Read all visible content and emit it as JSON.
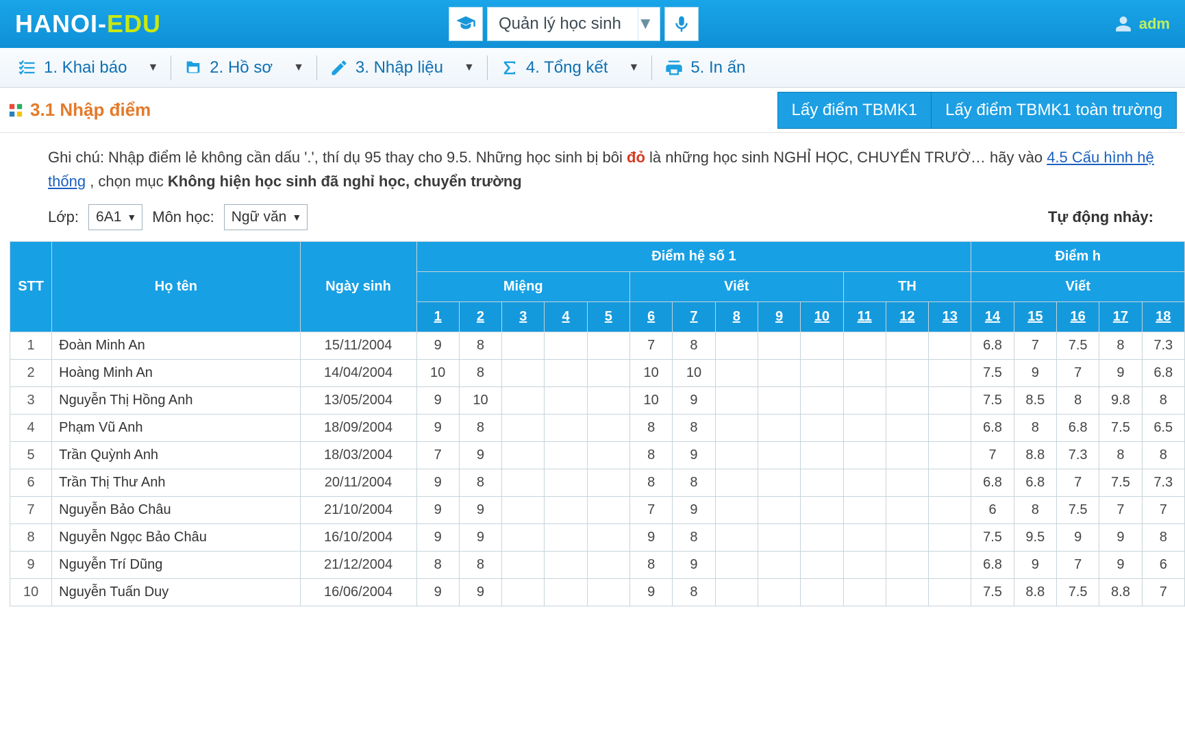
{
  "brand": {
    "part1": "HANOI-",
    "part2": "EDU"
  },
  "topbar": {
    "module_label": "Quản lý học sinh",
    "user": "adm"
  },
  "menu": {
    "m1": "1. Khai báo",
    "m2": "2. Hồ sơ",
    "m3": "3. Nhập liệu",
    "m4": "4. Tổng kết",
    "m5": "5. In ấn"
  },
  "section": {
    "title": "3.1 Nhập điểm",
    "btn1": "Lấy điểm TBMK1",
    "btn2": "Lấy điểm TBMK1 toàn trường"
  },
  "note": {
    "pre": "Ghi chú: Nhập điểm lẻ không cần dấu '.', thí dụ 95 thay cho 9.5. Những học sinh bị bôi ",
    "red": "đỏ",
    "post1": " là những học sinh NGHỈ HỌC, CHUYỂN TRƯỜ… hãy vào ",
    "link": "4.5 Cấu hình hệ thống",
    "post2": ", chọn mục ",
    "bold": "Không hiện học sinh đã nghỉ học, chuyển trường"
  },
  "filters": {
    "class_label": "Lớp:",
    "class_value": "6A1",
    "subject_label": "Môn học:",
    "subject_value": "Ngữ văn",
    "autojump": "Tự động nhảy:"
  },
  "table": {
    "headers": {
      "stt": "STT",
      "name": "Họ tên",
      "dob": "Ngày sinh",
      "group1": "Điểm hệ số 1",
      "group2": "Điểm h",
      "sub_mieng": "Miệng",
      "sub_viet": "Viết",
      "sub_th": "TH",
      "sub_viet2": "Viết",
      "cols": [
        "1",
        "2",
        "3",
        "4",
        "5",
        "6",
        "7",
        "8",
        "9",
        "10",
        "11",
        "12",
        "13",
        "14",
        "15",
        "16",
        "17",
        "18"
      ]
    },
    "rows": [
      {
        "stt": "1",
        "name": "Đoàn Minh An",
        "dob": "15/11/2004",
        "c": [
          "9",
          "8",
          "",
          "",
          "",
          "7",
          "8",
          "",
          "",
          "",
          "",
          "",
          "",
          "6.8",
          "7",
          "7.5",
          "8",
          "7.3"
        ]
      },
      {
        "stt": "2",
        "name": "Hoàng Minh An",
        "dob": "14/04/2004",
        "c": [
          "10",
          "8",
          "",
          "",
          "",
          "10",
          "10",
          "",
          "",
          "",
          "",
          "",
          "",
          "7.5",
          "9",
          "7",
          "9",
          "6.8"
        ]
      },
      {
        "stt": "3",
        "name": "Nguyễn Thị Hồng Anh",
        "dob": "13/05/2004",
        "c": [
          "9",
          "10",
          "",
          "",
          "",
          "10",
          "9",
          "",
          "",
          "",
          "",
          "",
          "",
          "7.5",
          "8.5",
          "8",
          "9.8",
          "8"
        ]
      },
      {
        "stt": "4",
        "name": "Phạm Vũ Anh",
        "dob": "18/09/2004",
        "c": [
          "9",
          "8",
          "",
          "",
          "",
          "8",
          "8",
          "",
          "",
          "",
          "",
          "",
          "",
          "6.8",
          "8",
          "6.8",
          "7.5",
          "6.5"
        ]
      },
      {
        "stt": "5",
        "name": "Trần Quỳnh Anh",
        "dob": "18/03/2004",
        "c": [
          "7",
          "9",
          "",
          "",
          "",
          "8",
          "9",
          "",
          "",
          "",
          "",
          "",
          "",
          "7",
          "8.8",
          "7.3",
          "8",
          "8"
        ]
      },
      {
        "stt": "6",
        "name": "Trần Thị Thư Anh",
        "dob": "20/11/2004",
        "c": [
          "9",
          "8",
          "",
          "",
          "",
          "8",
          "8",
          "",
          "",
          "",
          "",
          "",
          "",
          "6.8",
          "6.8",
          "7",
          "7.5",
          "7.3"
        ]
      },
      {
        "stt": "7",
        "name": "Nguyễn Bảo Châu",
        "dob": "21/10/2004",
        "c": [
          "9",
          "9",
          "",
          "",
          "",
          "7",
          "9",
          "",
          "",
          "",
          "",
          "",
          "",
          "6",
          "8",
          "7.5",
          "7",
          "7"
        ]
      },
      {
        "stt": "8",
        "name": "Nguyễn Ngọc Bảo Châu",
        "dob": "16/10/2004",
        "c": [
          "9",
          "9",
          "",
          "",
          "",
          "9",
          "8",
          "",
          "",
          "",
          "",
          "",
          "",
          "7.5",
          "9.5",
          "9",
          "9",
          "8"
        ]
      },
      {
        "stt": "9",
        "name": "Nguyễn Trí Dũng",
        "dob": "21/12/2004",
        "c": [
          "8",
          "8",
          "",
          "",
          "",
          "8",
          "9",
          "",
          "",
          "",
          "",
          "",
          "",
          "6.8",
          "9",
          "7",
          "9",
          "6"
        ]
      },
      {
        "stt": "10",
        "name": "Nguyễn Tuấn Duy",
        "dob": "16/06/2004",
        "c": [
          "9",
          "9",
          "",
          "",
          "",
          "9",
          "8",
          "",
          "",
          "",
          "",
          "",
          "",
          "7.5",
          "8.8",
          "7.5",
          "8.8",
          "7"
        ]
      }
    ]
  }
}
